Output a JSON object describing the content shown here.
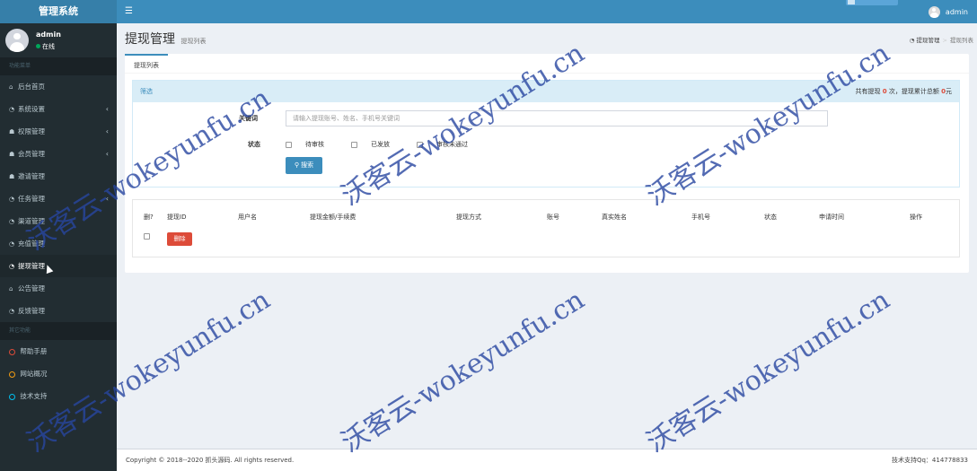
{
  "app": {
    "title": "管理系统",
    "toggle_icon": "bars-icon"
  },
  "topbar": {
    "username": "admin"
  },
  "sidebar": {
    "user": {
      "name": "admin",
      "status": "在线"
    },
    "section1": "功能菜单",
    "items": [
      {
        "label": "后台首页",
        "icon": "home-icon"
      },
      {
        "label": "系统设置",
        "icon": "dashboard-icon",
        "arrow": "‹"
      },
      {
        "label": "权限管理",
        "icon": "users-icon",
        "arrow": "‹"
      },
      {
        "label": "会员管理",
        "icon": "users-icon",
        "arrow": "‹"
      },
      {
        "label": "邀请管理",
        "icon": "users-icon"
      },
      {
        "label": "任务管理",
        "icon": "dashboard-icon",
        "arrow": "‹"
      },
      {
        "label": "渠道管理",
        "icon": "dashboard-icon"
      },
      {
        "label": "充值管理",
        "icon": "dashboard-icon"
      },
      {
        "label": "提现管理",
        "icon": "dashboard-icon"
      },
      {
        "label": "公告管理",
        "icon": "home-icon"
      },
      {
        "label": "反馈管理",
        "icon": "dashboard-icon"
      }
    ],
    "section2": "其它功能",
    "other_items": [
      {
        "label": "帮助手册",
        "color": "#dd4b39"
      },
      {
        "label": "网站概况",
        "color": "#f39c12"
      },
      {
        "label": "技术支持",
        "color": "#00c0ef"
      }
    ]
  },
  "page": {
    "title": "提现管理",
    "subtitle": "提现列表"
  },
  "breadcrumb": {
    "home": "提现管理",
    "current": "提现列表"
  },
  "tab": {
    "label": "提现列表"
  },
  "filter": {
    "heading": "筛选",
    "summary_prefix": "共有提现",
    "summary_count": "0",
    "summary_mid": "次，提现累计总额",
    "summary_amount": "0",
    "summary_suffix": "元",
    "keyword_label": "关键词",
    "keyword_placeholder": "请输入提现账号、姓名、手机号关键词",
    "status_label": "状态",
    "status_options": [
      "待审核",
      "已发放",
      "审核未通过"
    ],
    "search_button": "搜索"
  },
  "table": {
    "headers": [
      "删?",
      "提现ID",
      "用户名",
      "提现金额/手续费",
      "提现方式",
      "账号",
      "真实姓名",
      "手机号",
      "状态",
      "申请时间",
      "操作"
    ],
    "delete_button": "删除"
  },
  "footer": {
    "copyright": "Copyright © 2018--2020 抓头源码. All rights reserved.",
    "support": "技术支持Qq：414778833"
  },
  "watermark": "沃客云-wokeyunfu.cn",
  "colors": {
    "topbar": "#3c8dbc",
    "sidebar": "#222d32",
    "danger": "#dd4b39",
    "primary": "#3c8dbc"
  }
}
